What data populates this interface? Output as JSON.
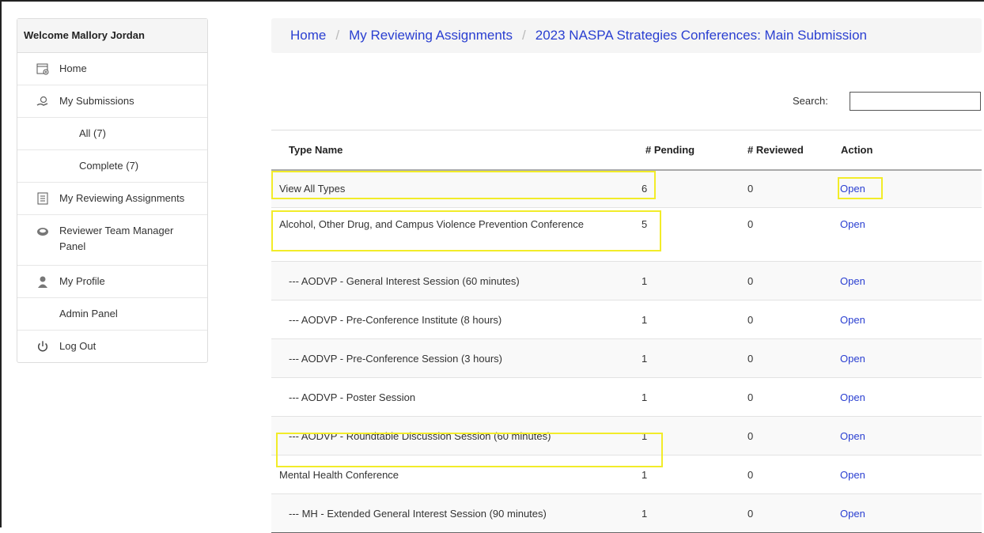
{
  "sidebar": {
    "welcome": "Welcome Mallory Jordan",
    "items": [
      {
        "label": "Home",
        "icon": "home-icon"
      },
      {
        "label": "My Submissions",
        "icon": "submissions-icon"
      },
      {
        "label": "All (7)"
      },
      {
        "label": "Complete (7)"
      },
      {
        "label": "My Reviewing Assignments",
        "icon": "assignments-icon"
      },
      {
        "label": "Reviewer Team Manager Panel",
        "icon": "team-manager-icon"
      },
      {
        "label": "My Profile",
        "icon": "profile-icon"
      },
      {
        "label": "Admin Panel"
      },
      {
        "label": "Log Out",
        "icon": "power-icon"
      }
    ]
  },
  "breadcrumb": {
    "home": "Home",
    "assignments": "My Reviewing Assignments",
    "current": "2023 NASPA Strategies Conferences: Main Submission",
    "separator": "/"
  },
  "search": {
    "label": "Search:",
    "value": ""
  },
  "table": {
    "columns": [
      "Type Name",
      "# Pending",
      "# Reviewed",
      "Action"
    ],
    "rows": [
      {
        "name": "View All Types",
        "pending": "6",
        "reviewed": "0",
        "action": "Open"
      },
      {
        "name": "Alcohol, Other Drug, and Campus Violence Prevention Conference",
        "pending": "5",
        "reviewed": "0",
        "action": "Open"
      },
      {
        "name": "--- AODVP - General Interest Session (60 minutes)",
        "pending": "1",
        "reviewed": "0",
        "action": "Open"
      },
      {
        "name": "--- AODVP - Pre-Conference Institute (8 hours)",
        "pending": "1",
        "reviewed": "0",
        "action": "Open"
      },
      {
        "name": "--- AODVP - Pre-Conference Session (3 hours)",
        "pending": "1",
        "reviewed": "0",
        "action": "Open"
      },
      {
        "name": "--- AODVP - Poster Session",
        "pending": "1",
        "reviewed": "0",
        "action": "Open"
      },
      {
        "name": "--- AODVP - Roundtable Discussion Session (60 minutes)",
        "pending": "1",
        "reviewed": "0",
        "action": "Open"
      },
      {
        "name": "Mental Health Conference",
        "pending": "1",
        "reviewed": "0",
        "action": "Open"
      },
      {
        "name": "--- MH - Extended General Interest Session (90 minutes)",
        "pending": "1",
        "reviewed": "0",
        "action": "Open"
      }
    ]
  },
  "colors": {
    "link": "#2a3fd1",
    "highlight": "#f2ec29",
    "header_bg": "#f5f5f5"
  }
}
